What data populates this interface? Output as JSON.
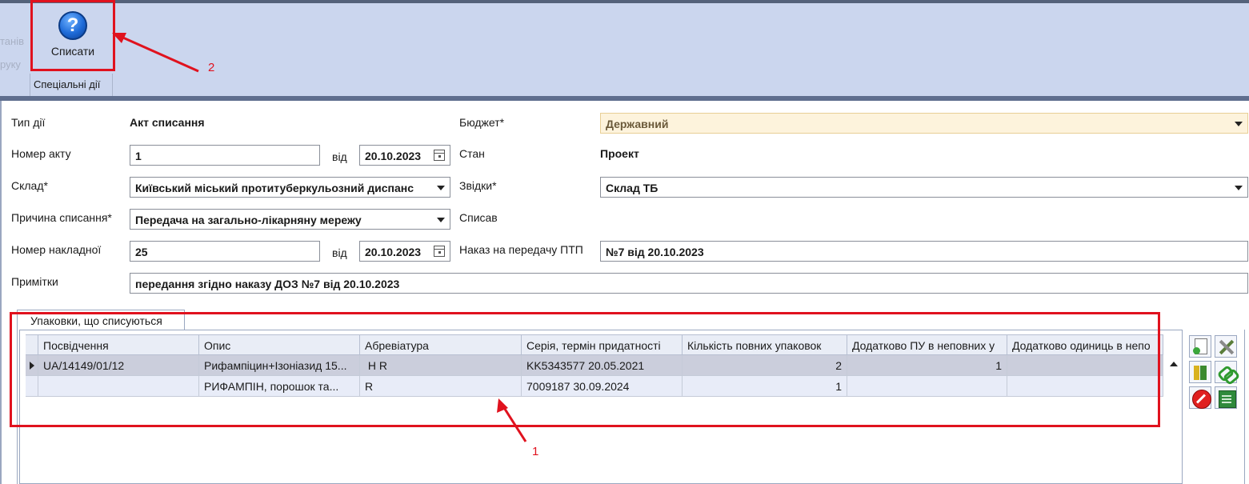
{
  "ribbon": {
    "ghost_text_1": "танів",
    "ghost_text_2": "руку",
    "button_label": "Списати",
    "group_label": "Спеціальні дії",
    "icon": "help-icon"
  },
  "form": {
    "action_type": {
      "label": "Тип дії",
      "value": "Акт списання"
    },
    "budget": {
      "label": "Бюджет*",
      "value": "Державний"
    },
    "act_number": {
      "label": "Номер акту",
      "value": "1",
      "from_label": "від",
      "date": "20.10.2023"
    },
    "state": {
      "label": "Стан",
      "value": "Проект"
    },
    "warehouse": {
      "label": "Склад*",
      "value": "Київський міський протитуберкульозний диспанс"
    },
    "source": {
      "label": "Звідки*",
      "value": "Склад ТБ"
    },
    "reason": {
      "label": "Причина списання*",
      "value": "Передача на загально-лікарняну мережу"
    },
    "written_off_by": {
      "label": "Списав"
    },
    "invoice_number": {
      "label": "Номер накладної",
      "value": "25",
      "from_label": "від",
      "date": "20.10.2023"
    },
    "order": {
      "label": "Наказ на передачу ПТП",
      "value": "№7 від 20.10.2023"
    },
    "notes": {
      "label": "Примітки",
      "value": "передання згідно наказу ДОЗ №7 від 20.10.2023"
    }
  },
  "tab": {
    "label": "Упаковки, що списуються"
  },
  "grid": {
    "columns": [
      "Посвідчення",
      "Опис",
      "Абревіатура",
      "Серія, термін придатності",
      "Кількість повних упаковок",
      "Додатково ПУ в неповних у",
      "Додатково одиниць в непо"
    ],
    "rows": [
      {
        "certificate": "UA/14149/01/12",
        "description": "Рифампіцин+Ізоніазид 15...",
        "abbr": " H R",
        "series": "KK5343577 20.05.2021",
        "full_packs": "2",
        "extra_pu": "1",
        "extra_units": ""
      },
      {
        "certificate": "",
        "description": "РИФАМПІН, порошок та...",
        "abbr": "R",
        "series": "7009187 30.09.2024",
        "full_packs": "1",
        "extra_pu": "",
        "extra_units": ""
      }
    ]
  },
  "toolbar_icons": [
    "add-document-icon",
    "tools-icon",
    "books-icon",
    "link-icon",
    "delete-icon",
    "spreadsheet-icon"
  ],
  "annotations": {
    "label_1": "1",
    "label_2": "2",
    "color": "#e0121e"
  },
  "colors": {
    "ribbon_bg": "#cbd6ee",
    "ribbon_border": "#5f6e8e",
    "selected_row": "#cbcedc",
    "row_alt": "#e8ecf8",
    "budget_bg": "#fdf3dc"
  }
}
